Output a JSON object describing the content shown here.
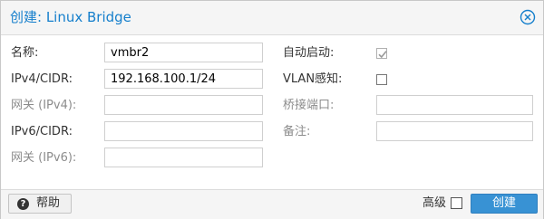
{
  "dialog": {
    "title": "创建: Linux Bridge",
    "close_icon": "close-circle-icon"
  },
  "left": {
    "name_label": "名称:",
    "name_value": "vmbr2",
    "ipv4_label": "IPv4/CIDR:",
    "ipv4_value": "192.168.100.1/24",
    "gw4_label": "网关 (IPv4):",
    "gw4_value": "",
    "ipv6_label": "IPv6/CIDR:",
    "ipv6_value": "",
    "gw6_label": "网关 (IPv6):",
    "gw6_value": ""
  },
  "right": {
    "autostart_label": "自动启动:",
    "autostart_checked": true,
    "vlan_label": "VLAN感知:",
    "vlan_checked": false,
    "ports_label": "桥接端口:",
    "ports_value": "",
    "comment_label": "备注:",
    "comment_value": ""
  },
  "footer": {
    "help_label": "帮助",
    "help_icon": "question-circle-icon",
    "advanced_label": "高级",
    "advanced_checked": false,
    "create_label": "创建"
  },
  "colors": {
    "title": "#157fcc",
    "primary_button": "#3892d4",
    "disabled_label": "#8c8c8c"
  }
}
